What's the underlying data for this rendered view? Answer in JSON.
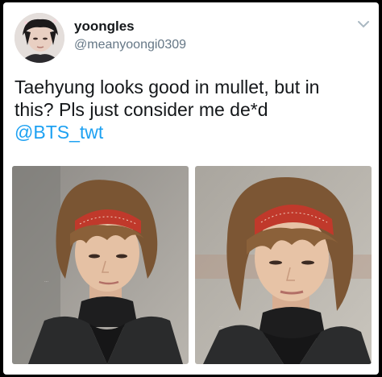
{
  "tweet": {
    "display_name": "yoongles",
    "handle": "@meanyoongi0309",
    "text_line1": "Taehyung looks good in mullet, but in",
    "text_line2": "this? Pls just consider me de*d",
    "mention": "@BTS_twt",
    "avatar_icon": "profile-photo",
    "menu_icon": "chevron-down-icon"
  },
  "media": [
    {
      "icon": "photo-left",
      "watermark": "..."
    },
    {
      "icon": "photo-right",
      "watermark": "..."
    }
  ],
  "colors": {
    "text": "#14171a",
    "secondary": "#657786",
    "link": "#1da1f2",
    "headband": "#c0392b"
  }
}
